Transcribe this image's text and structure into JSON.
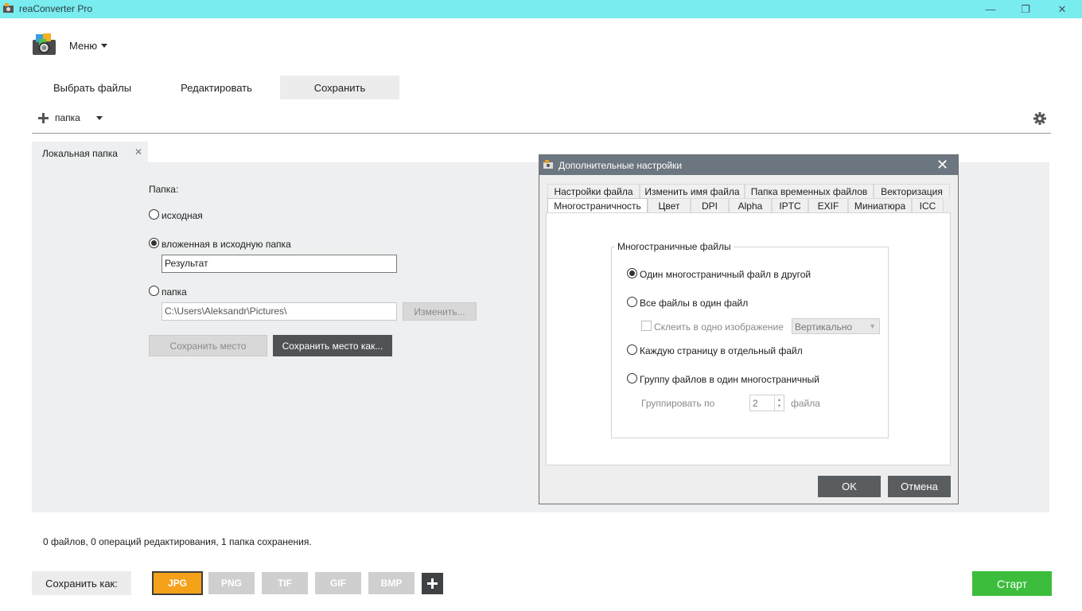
{
  "window": {
    "title": "reaConverter Pro",
    "minimize": "—",
    "maximize": "❐",
    "close": "✕"
  },
  "menu": {
    "label": "Меню"
  },
  "main_tabs": [
    {
      "label": "Выбрать файлы"
    },
    {
      "label": "Редактировать"
    },
    {
      "label": "Сохранить",
      "active": true
    }
  ],
  "toolbar": {
    "add_folder_label": "папка"
  },
  "location_tab": {
    "label": "Локальная папка",
    "close": "✕"
  },
  "folder_options": {
    "heading": "Папка:",
    "option_source": "исходная",
    "option_subfolder": "вложенная в исходную папка",
    "subfolder_value": "Результат",
    "option_folder": "папка",
    "folder_path": "C:\\Users\\Aleksandr\\Pictures\\",
    "change_button": "Изменить...",
    "save_location_button": "Сохранить место",
    "save_location_as_button": "Сохранить место как...",
    "selected": "subfolder"
  },
  "dialog": {
    "title": "Дополнительные настройки",
    "close": "✕",
    "tabs_row1": [
      "Настройки файла",
      "Изменить имя файла",
      "Папка временных файлов",
      "Векторизация"
    ],
    "tabs_row2": [
      "Многостраничность",
      "Цвет",
      "DPI",
      "Alpha",
      "IPTC",
      "EXIF",
      "Миниатюра",
      "ICC"
    ],
    "active_tab": "Многостраничность",
    "group_title": "Многостраничные файлы",
    "opt_one_to_other": "Один многостраничный файл в другой",
    "opt_all_in_one": "Все файлы в один файл",
    "merge_label": "Склеить в одно изображение",
    "merge_direction": "Вертикально",
    "opt_each_page": "Каждую страницу в отдельный файл",
    "opt_group": "Группу файлов в один многостраничный",
    "group_by_label": "Группировать по",
    "group_by_value": "2",
    "group_by_unit": "файла",
    "ok": "OK",
    "cancel": "Отмена"
  },
  "status": "0 файлов, 0 операций редактирования, 1 папка сохранения.",
  "footer": {
    "save_as_label": "Сохранить как:",
    "formats": [
      "JPG",
      "PNG",
      "TIF",
      "GIF",
      "BMP"
    ],
    "active_format": "JPG",
    "start": "Старт"
  },
  "colors": {
    "titlebar": "#79ecf0",
    "active_format": "#f5a21a",
    "start": "#3cbe3c",
    "dialog_title": "#6c7680"
  }
}
